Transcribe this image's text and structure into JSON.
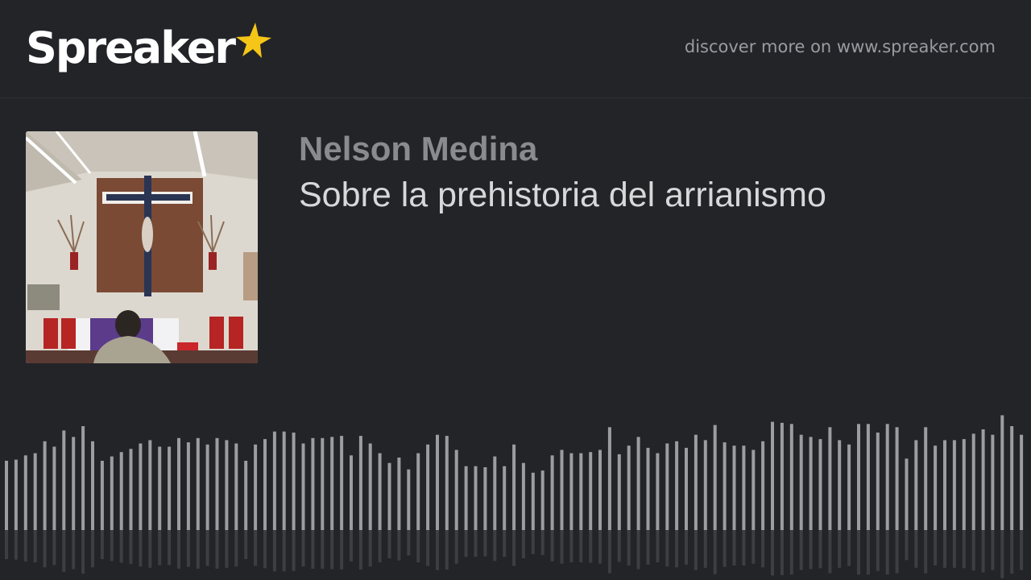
{
  "header": {
    "logo_text": "Spreaker",
    "logo_icon": "star-icon",
    "discover_text": "discover more on www.spreaker.com"
  },
  "podcast": {
    "author": "Nelson Medina",
    "episode_title": "Sobre la prehistoria del arrianismo",
    "cover_icon": "church-altar-crucifix-photo"
  },
  "waveform": {
    "levels": [
      0.64,
      0.65,
      0.69,
      0.71,
      0.82,
      0.77,
      0.92,
      0.86,
      0.96,
      0.82,
      0.64,
      0.68,
      0.72,
      0.75,
      0.8,
      0.83,
      0.77,
      0.77,
      0.85,
      0.81,
      0.85,
      0.79,
      0.85,
      0.83,
      0.8,
      0.64,
      0.79,
      0.84,
      0.91,
      0.91,
      0.9,
      0.8,
      0.85,
      0.85,
      0.86,
      0.87,
      0.69,
      0.87,
      0.8,
      0.71,
      0.62,
      0.67,
      0.56,
      0.71,
      0.79,
      0.88,
      0.87,
      0.74,
      0.59,
      0.59,
      0.58,
      0.68,
      0.59,
      0.79,
      0.62,
      0.53,
      0.55,
      0.69,
      0.74,
      0.71,
      0.71,
      0.72,
      0.74,
      0.95,
      0.7,
      0.78,
      0.86,
      0.76,
      0.71,
      0.8,
      0.82,
      0.76,
      0.88,
      0.83,
      0.97,
      0.81,
      0.78,
      0.78,
      0.74,
      0.82,
      1.0,
      0.99,
      0.98,
      0.88,
      0.86,
      0.84,
      0.95,
      0.83,
      0.79,
      0.98,
      0.98,
      0.9,
      0.98,
      0.95,
      0.66,
      0.83,
      0.95,
      0.78,
      0.83,
      0.83,
      0.84,
      0.89,
      0.93,
      0.88,
      1.06,
      0.96,
      0.88
    ],
    "bar_color": "#9c9da1"
  }
}
